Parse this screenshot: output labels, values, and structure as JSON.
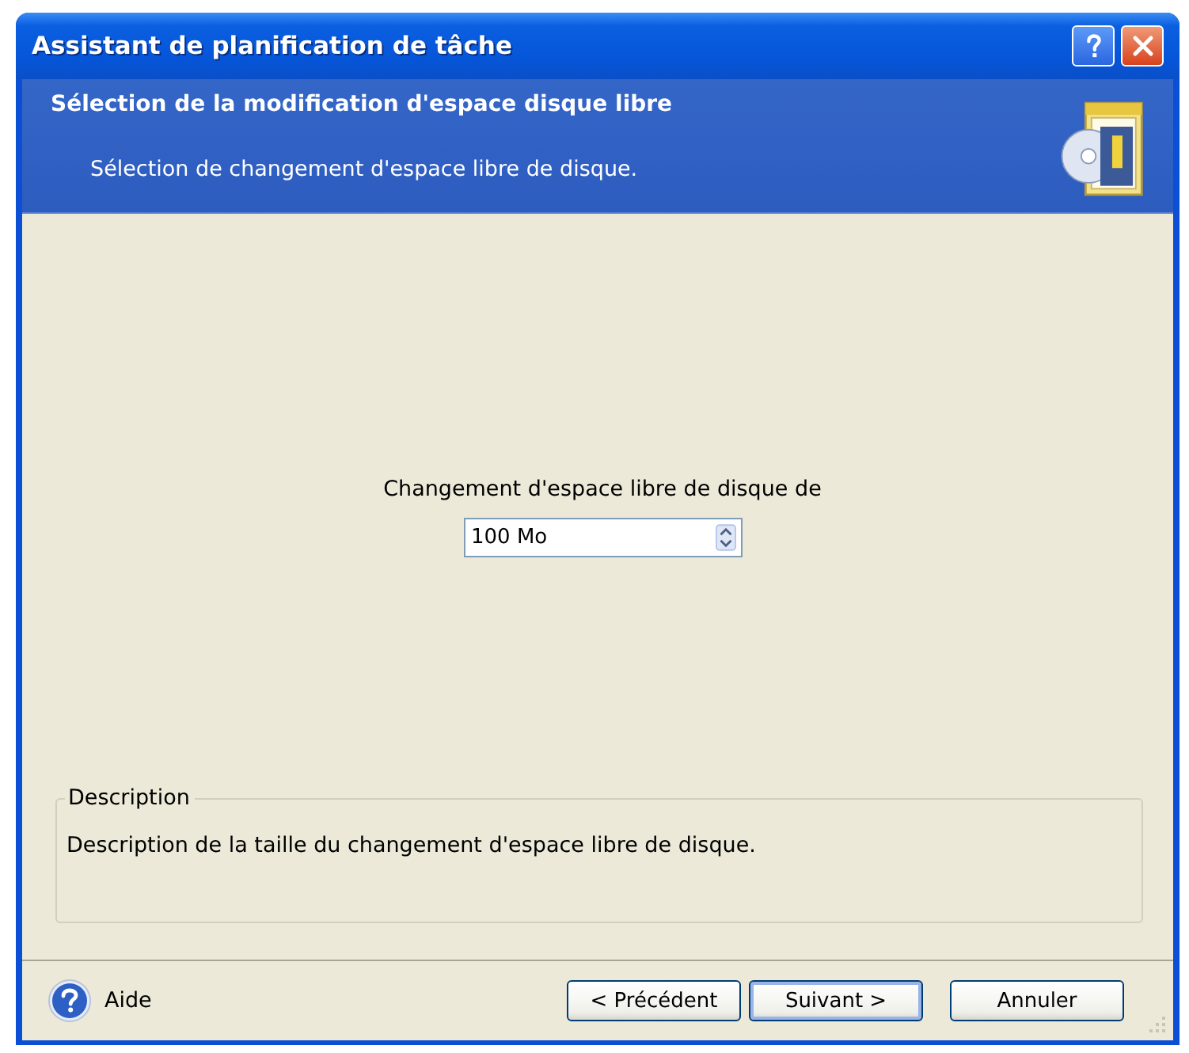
{
  "window": {
    "title": "Assistant de planification de tâche"
  },
  "header": {
    "title": "Sélection de la modification d'espace disque libre",
    "subtitle": "Sélection de changement d'espace libre de disque."
  },
  "content": {
    "label": "Changement d'espace libre de disque de",
    "spinbox": {
      "value": "100 Mo"
    }
  },
  "description": {
    "legend": "Description",
    "text": "Description de la taille du changement d'espace libre de disque."
  },
  "footer": {
    "help_link": "Aide",
    "buttons": [
      {
        "label": "< Précédent",
        "default": false
      },
      {
        "label": "Suivant >",
        "default": true
      },
      {
        "label": "Annuler",
        "default": false
      }
    ]
  }
}
